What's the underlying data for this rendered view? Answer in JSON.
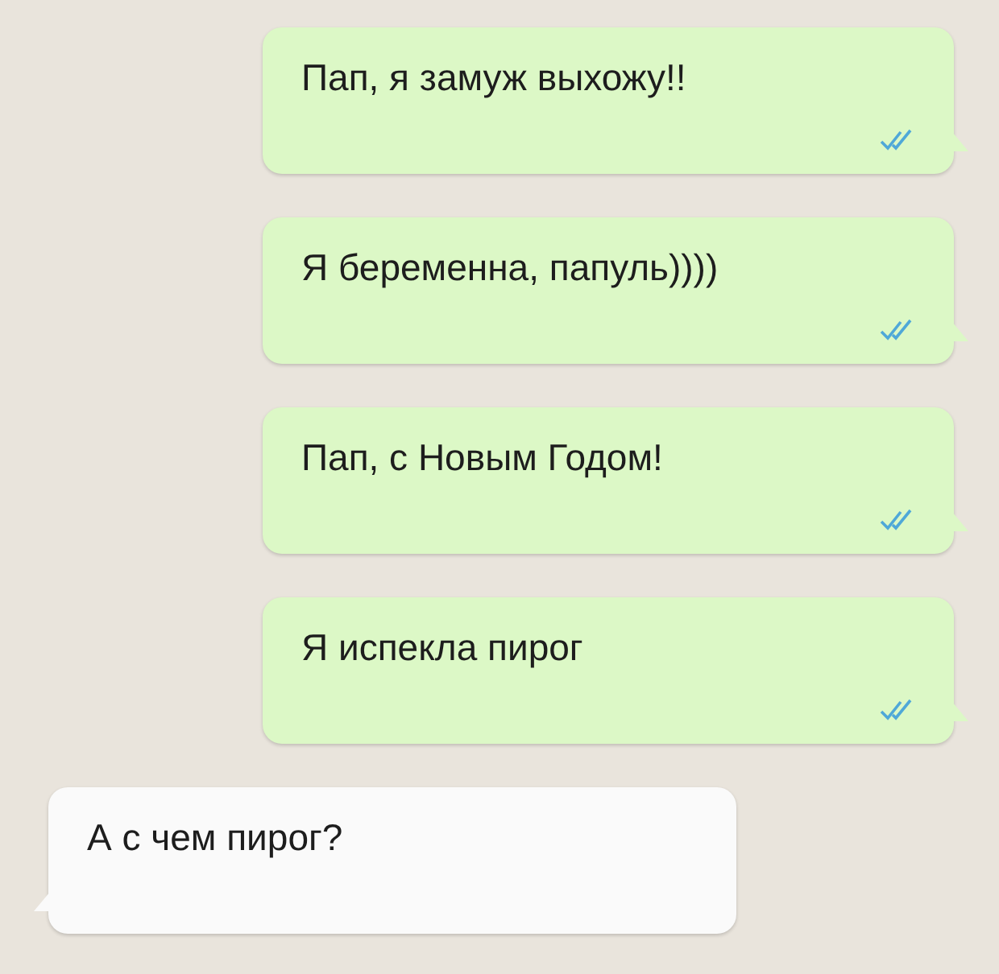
{
  "messages": [
    {
      "kind": "outgoing",
      "text": "Пап, я замуж выхожу!!",
      "read": true
    },
    {
      "kind": "outgoing",
      "text": "Я беременна, папуль))))",
      "read": true
    },
    {
      "kind": "outgoing",
      "text": "Пап, с Новым Годом!",
      "read": true
    },
    {
      "kind": "outgoing",
      "text": "Я испекла пирог",
      "read": true
    },
    {
      "kind": "incoming",
      "text": "А с чем пирог?"
    }
  ]
}
